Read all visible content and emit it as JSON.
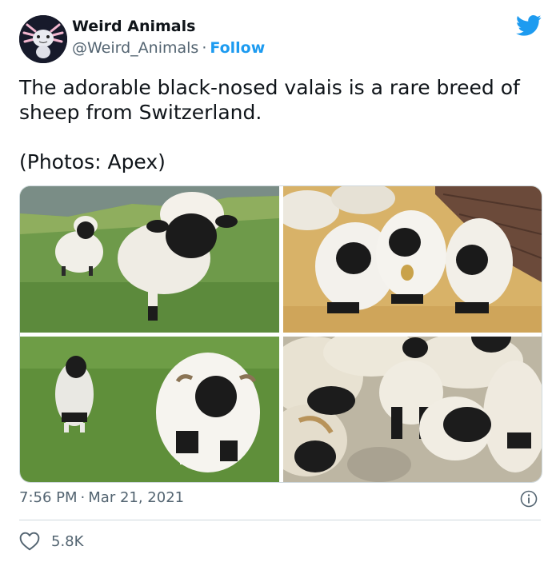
{
  "author": {
    "name": "Weird Animals",
    "handle": "@Weird_Animals",
    "separator": "·",
    "follow_label": "Follow"
  },
  "tweet": {
    "text": "The adorable black-nosed valais is a rare breed of sheep from Switzerland.",
    "credit": "(Photos: Apex)"
  },
  "meta": {
    "time": "7:56 PM",
    "separator": "·",
    "date": "Mar 21, 2021"
  },
  "engagement": {
    "likes": "5.8K"
  },
  "icons": {
    "brand": "twitter-bird-icon",
    "info": "info-icon",
    "like": "heart-icon"
  },
  "colors": {
    "accent": "#1d9bf0",
    "secondary_text": "#536471",
    "primary_text": "#0f1419",
    "border": "#cfd9de"
  }
}
